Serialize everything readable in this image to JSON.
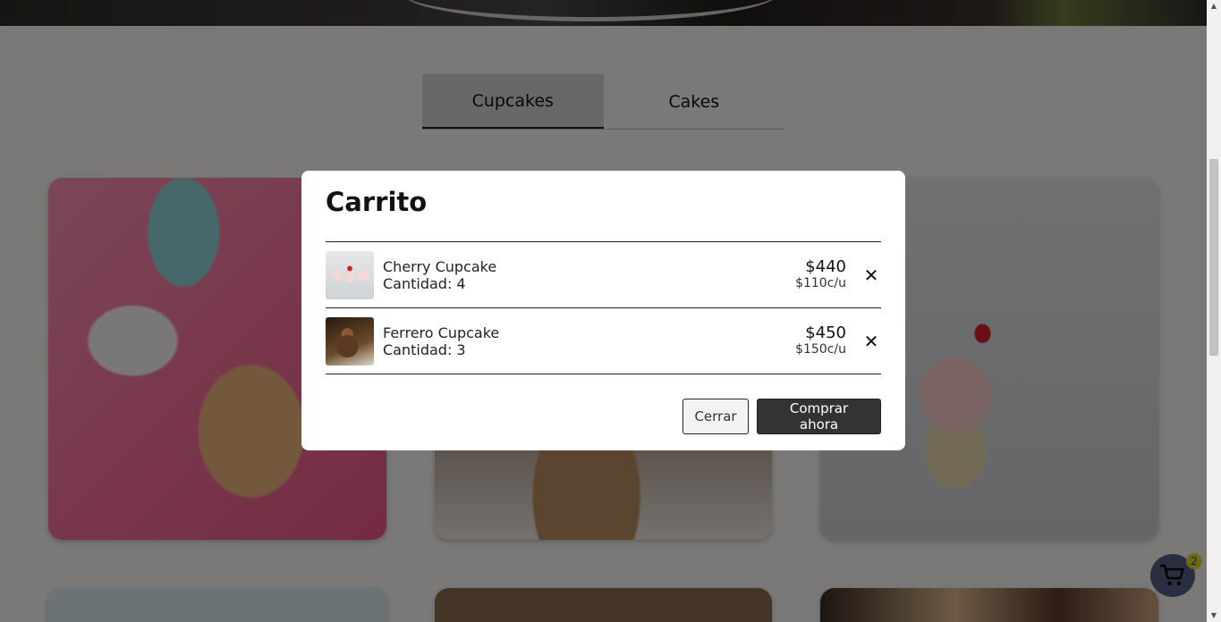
{
  "tabs": [
    {
      "label": "Cupcakes",
      "active": true
    },
    {
      "label": "Cakes",
      "active": false
    }
  ],
  "cart": {
    "title": "Carrito",
    "items": [
      {
        "name": "Cherry Cupcake",
        "quantity": "Cantidad: 4",
        "total": "$440",
        "unit": "$110c/u",
        "thumb_icon": "cherry-cupcake-thumbnail"
      },
      {
        "name": "Ferrero Cupcake",
        "quantity": "Cantidad: 3",
        "total": "$450",
        "unit": "$150c/u",
        "thumb_icon": "ferrero-cupcake-thumbnail"
      }
    ],
    "remove_icon": "close-icon",
    "close_label": "Cerrar",
    "buy_label": "Comprar ahora"
  },
  "fab": {
    "icon": "shopping-cart-icon",
    "badge": "2"
  },
  "colors": {
    "primary_button": "#333333",
    "badge": "#6b6a17"
  }
}
